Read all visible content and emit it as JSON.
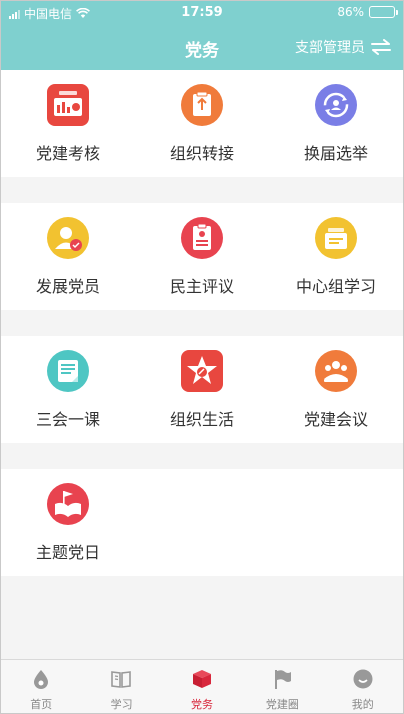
{
  "status_bar": {
    "carrier": "中国电信",
    "time": "17:59",
    "battery": "86%",
    "battery_level": 0.86
  },
  "nav": {
    "title": "党务",
    "role_label": "支部管理员",
    "switch_icon": "swap-arrows-icon"
  },
  "grid": [
    [
      {
        "label": "党建考核",
        "icon": "assessment-chart-icon",
        "color": "#e8473f"
      },
      {
        "label": "组织转接",
        "icon": "transfer-clipboard-icon",
        "color": "#f07b3b"
      },
      {
        "label": "换届选举",
        "icon": "election-refresh-icon",
        "color": "#7a7ee6"
      }
    ],
    [
      {
        "label": "发展党员",
        "icon": "member-badge-icon",
        "color": "#f2c230"
      },
      {
        "label": "民主评议",
        "icon": "review-document-icon",
        "color": "#e8434f"
      },
      {
        "label": "中心组学习",
        "icon": "study-folder-icon",
        "color": "#f2c230"
      }
    ],
    [
      {
        "label": "三会一课",
        "icon": "meeting-notes-icon",
        "color": "#4ec6c3"
      },
      {
        "label": "组织生活",
        "icon": "star-party-icon",
        "color": "#e8473f"
      },
      {
        "label": "党建会议",
        "icon": "conference-people-icon",
        "color": "#f07b3b"
      }
    ],
    [
      {
        "label": "主题党日",
        "icon": "theme-day-book-icon",
        "color": "#e8434f"
      }
    ]
  ],
  "tabbar": [
    {
      "label": "首页",
      "icon": "home-drop-icon",
      "active": false
    },
    {
      "label": "学习",
      "icon": "study-book-icon",
      "active": false
    },
    {
      "label": "党务",
      "icon": "party-cube-icon",
      "active": true
    },
    {
      "label": "党建圈",
      "icon": "flag-icon",
      "active": false
    },
    {
      "label": "我的",
      "icon": "profile-face-icon",
      "active": false
    }
  ],
  "colors": {
    "header": "#7fd0cf",
    "active_tab": "#d8273c"
  }
}
